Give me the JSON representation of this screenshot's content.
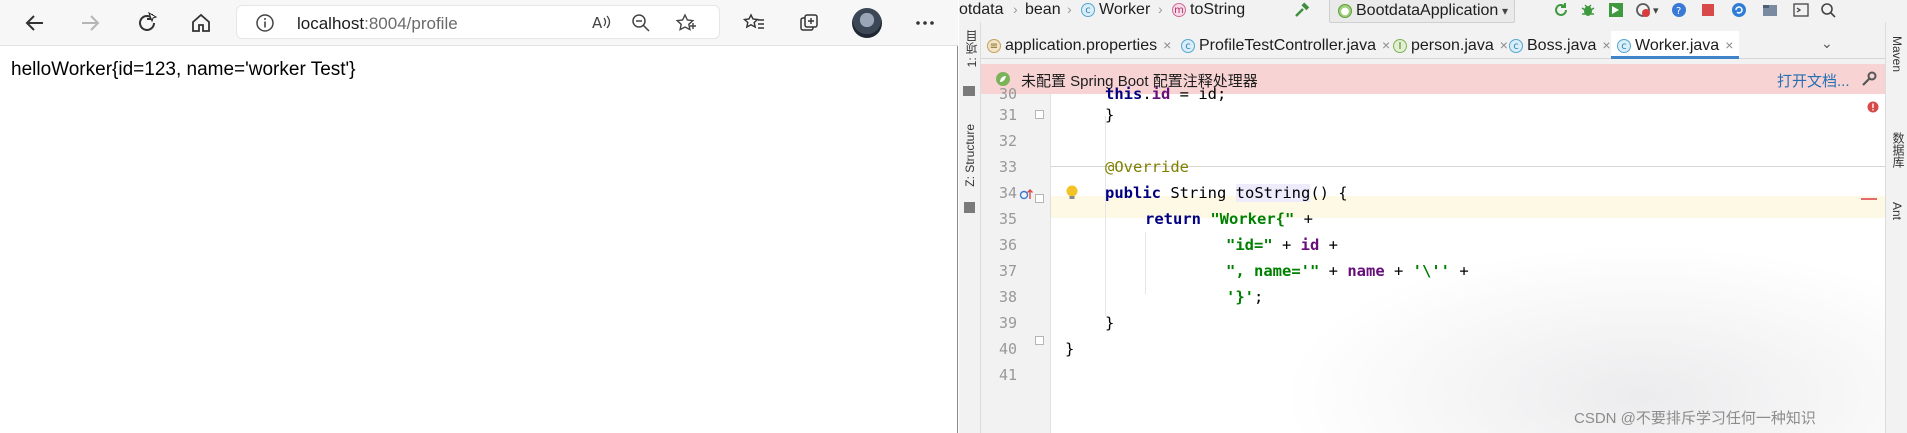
{
  "browser": {
    "url_host": "localhost",
    "url_rest": ":8004/profile",
    "page_text": "helloWorker{id=123, name='worker Test'}"
  },
  "ide": {
    "breadcrumbs": [
      "otdata",
      "bean",
      "Worker",
      "toString"
    ],
    "run_config": "BootdataApplication",
    "tabs": [
      {
        "label": "application.properties",
        "close": "×",
        "active": false
      },
      {
        "label": "ProfileTestController.java",
        "close": "×",
        "active": false
      },
      {
        "label": "person.java",
        "close": "×",
        "active": false
      },
      {
        "label": "Boss.java",
        "close": "×",
        "active": false
      },
      {
        "label": "Worker.java",
        "close": "×",
        "active": true
      }
    ],
    "left_strip": [
      "1: 项目",
      "Z: Structure"
    ],
    "right_strip": [
      "Maven",
      "数据库",
      "Ant"
    ],
    "banner": {
      "text": "未配置 Spring Boot 配置注释处理器",
      "link": "打开文档..."
    },
    "line_numbers": [
      "30",
      "31",
      "32",
      "33",
      "34",
      "35",
      "36",
      "37",
      "38",
      "39",
      "40",
      "41"
    ],
    "code": {
      "l30_kw": "this",
      "l30_rest": ".",
      "l30_field": "id",
      "l30_tail": " = id;",
      "l31": "}",
      "l33": "@Override",
      "l34_kw": "public",
      "l34_type": " String ",
      "l34_method": "toString",
      "l34_tail": "() {",
      "l35_kw": "return",
      "l35_str": "\"Worker{\"",
      "l35_tail": " +",
      "l36_str": "\"id=\"",
      "l36_mid": " + ",
      "l36_field": "id",
      "l36_tail": " +",
      "l37_str": "\", name='\"",
      "l37_mid": " + ",
      "l37_field": "name",
      "l37_mid2": " + ",
      "l37_str2": "'\\''",
      "l37_tail": " +",
      "l38_str": "'}'",
      "l38_tail": ";",
      "l39": "}",
      "l40": "}"
    },
    "watermark": "CSDN @不要排斥学习任何一种知识"
  },
  "colors": {
    "accent_tab": "#4083c9",
    "banner_bg": "#f7d3d3",
    "keyword": "#000080",
    "string": "#008000",
    "field": "#660e7a"
  }
}
